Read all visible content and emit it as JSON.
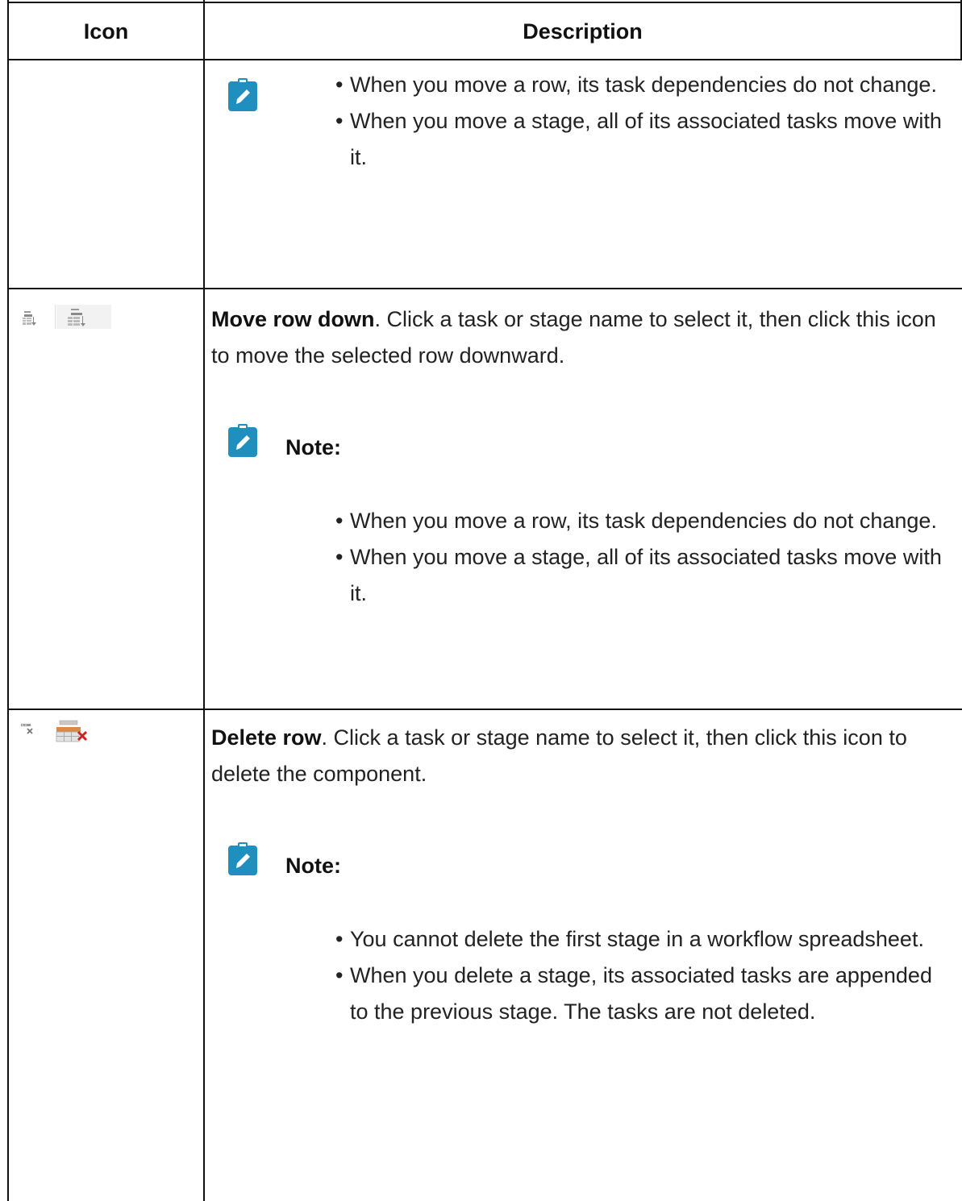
{
  "table": {
    "headers": {
      "icon": "Icon",
      "description": "Description"
    },
    "rows": [
      {
        "note_bullets": [
          "When you move a row, its task dependencies do not change.",
          "When you move a stage, all of its associated tasks move with it."
        ]
      },
      {
        "icon": "move-row-down-icon",
        "title": "Move row down",
        "text": ". Click a task or stage name to select it, then click this icon to move the selected row downward.",
        "note_label": "Note:",
        "note_bullets": [
          "When you move a row, its task dependencies do not change.",
          "When you move a stage, all of its associated tasks move with it."
        ]
      },
      {
        "icon": "delete-row-icon",
        "title": "Delete row",
        "text": ". Click a task or stage name to select it, then click this icon to delete the component.",
        "note_label": "Note:",
        "note_bullets": [
          "You cannot delete the first stage in a workflow spreadsheet.",
          "When you delete a stage, its associated tasks are appended to the previous stage. The tasks are not deleted."
        ]
      }
    ]
  },
  "colors": {
    "note_icon_bg": "#1e8fbf",
    "border": "#111111",
    "delete_x": "#cc2222"
  }
}
